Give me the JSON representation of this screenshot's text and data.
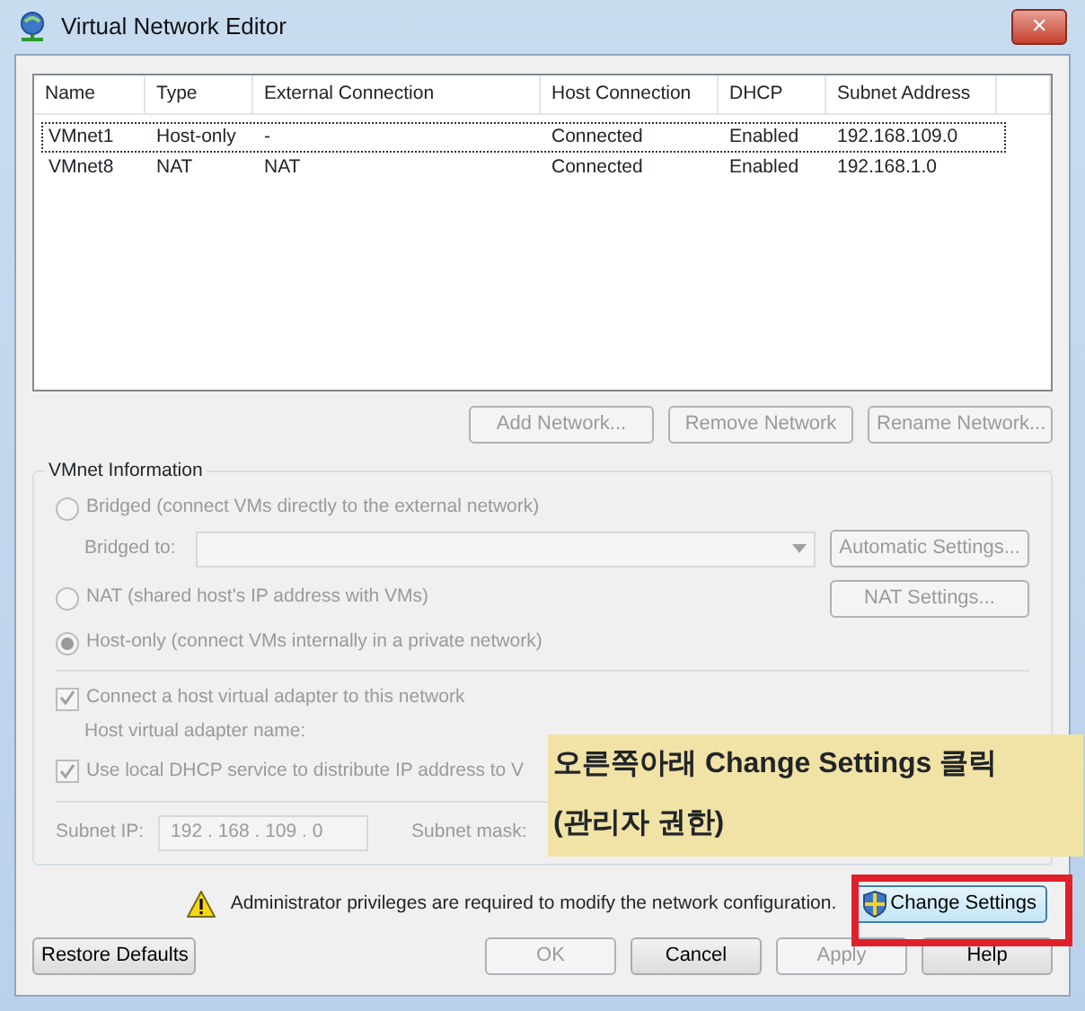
{
  "window": {
    "title": "Virtual Network Editor",
    "close": "✕"
  },
  "table": {
    "columns": [
      "Name",
      "Type",
      "External Connection",
      "Host Connection",
      "DHCP",
      "Subnet Address"
    ],
    "rows": [
      {
        "cells": [
          "VMnet1",
          "Host-only",
          "-",
          "Connected",
          "Enabled",
          "192.168.109.0"
        ],
        "selected": true
      },
      {
        "cells": [
          "VMnet8",
          "NAT",
          "NAT",
          "Connected",
          "Enabled",
          "192.168.1.0"
        ],
        "selected": false
      }
    ]
  },
  "list_buttons": [
    {
      "label": "Add Network...",
      "disabled": true
    },
    {
      "label": "Remove Network",
      "disabled": true
    },
    {
      "label": "Rename Network...",
      "disabled": true
    }
  ],
  "vmnet_info": {
    "title": "VMnet Information",
    "modes": [
      {
        "label": "Bridged (connect VMs directly to the external network)",
        "selected": false,
        "disabled": true
      },
      {
        "label": "NAT (shared host's IP address with VMs)",
        "selected": false,
        "disabled": true
      },
      {
        "label": "Host-only (connect VMs internally in a private network)",
        "selected": true,
        "disabled": true
      }
    ],
    "bridged_to_label": "Bridged to:",
    "automatic_settings": {
      "label": "Automatic Settings...",
      "disabled": true
    },
    "nat_settings": {
      "label": "NAT Settings...",
      "disabled": true
    },
    "connect_adapter": {
      "label": "Connect a host virtual adapter to this network",
      "checked": true,
      "disabled": true
    },
    "adapter_name_label": "Host virtual adapter name:",
    "use_dhcp": {
      "label": "Use local DHCP service to distribute IP address to V",
      "checked": true,
      "disabled": true
    },
    "subnet_ip_label": "Subnet IP:",
    "subnet_ip": "192 . 168 . 109 .  0",
    "subnet_mask_label": "Subnet mask:"
  },
  "warning": {
    "text": "Administrator privileges are required to modify the network configuration.",
    "button": "Change Settings"
  },
  "footer_buttons": [
    {
      "label": "Restore Defaults",
      "disabled": false
    },
    {
      "label": "OK",
      "disabled": true
    },
    {
      "label": "Cancel",
      "disabled": false
    },
    {
      "label": "Apply",
      "disabled": true
    },
    {
      "label": "Help",
      "disabled": false
    }
  ],
  "annotation": {
    "lines": [
      "오른쪽아래 Change Settings 클릭",
      "(관리자 권한)"
    ]
  }
}
